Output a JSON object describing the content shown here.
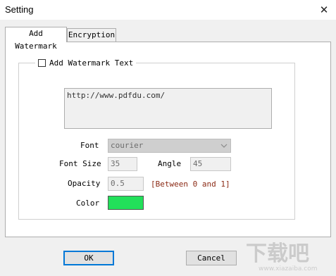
{
  "window": {
    "title": "Setting"
  },
  "tabs": [
    {
      "label": "Add Watermark",
      "active": true
    },
    {
      "label": "Encryption",
      "active": false
    }
  ],
  "watermark_group": {
    "checkbox_label": "Add Watermark Text",
    "checked": false,
    "text_value": "http://www.pdfdu.com/"
  },
  "form": {
    "font_label": "Font",
    "font_value": "courier",
    "font_size_label": "Font Size",
    "font_size_value": "35",
    "angle_label": "Angle",
    "angle_value": "45",
    "opacity_label": "Opacity",
    "opacity_value": "0.5",
    "opacity_hint": "[Between 0 and 1]",
    "color_label": "Color",
    "color_value": "#22e05a"
  },
  "buttons": {
    "ok": "OK",
    "cancel": "Cancel"
  },
  "icons": {
    "close": "close-icon",
    "chevron": "chevron-down-icon",
    "checkbox": "checkbox-icon"
  },
  "logo": {
    "text": "下载吧",
    "sub": "www.xiazaiba.com"
  }
}
